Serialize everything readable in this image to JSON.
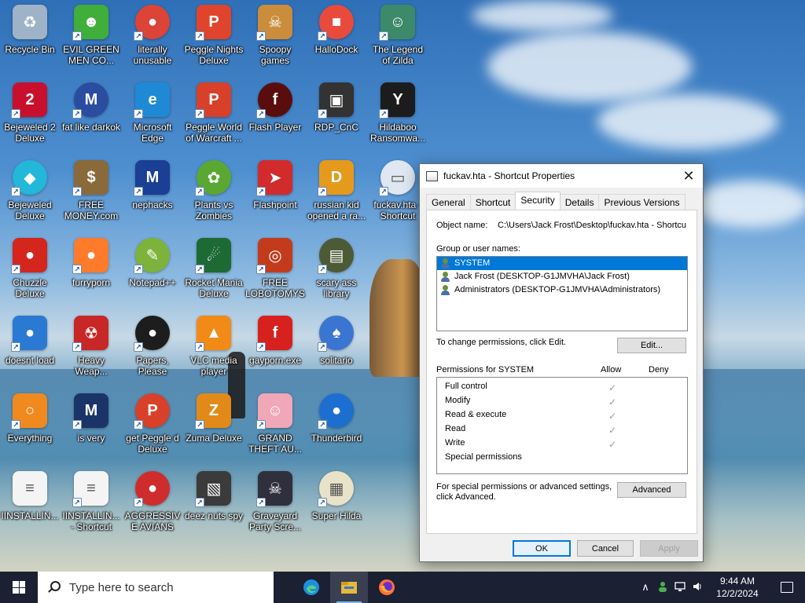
{
  "desktop": {
    "icons": [
      {
        "label": "Recycle Bin",
        "glyph": "♻",
        "color": "#9fb3c8",
        "shortcut": false
      },
      {
        "label": "EVIL GREEN MEN CO...",
        "glyph": "☻",
        "color": "#3fae3a",
        "shortcut": true
      },
      {
        "label": "literally unusable",
        "glyph": "●",
        "color": "#db4437",
        "shortcut": true
      },
      {
        "label": "Peggle Nights Deluxe",
        "glyph": "P",
        "color": "#e0442c",
        "shortcut": true
      },
      {
        "label": "Spoopy games",
        "glyph": "☠",
        "color": "#c98d3c",
        "shortcut": true
      },
      {
        "label": "HalloDock",
        "glyph": "■",
        "color": "#e84b3c",
        "shortcut": true
      },
      {
        "label": "The Legend of Zilda",
        "glyph": "☺",
        "color": "#3c8a6a",
        "shortcut": true
      },
      {
        "label": "Bejeweled 2 Deluxe",
        "glyph": "2",
        "color": "#c8102e",
        "shortcut": true
      },
      {
        "label": "fat like darkok",
        "glyph": "M",
        "color": "#2a4da0",
        "shortcut": true
      },
      {
        "label": "Microsoft Edge",
        "glyph": "e",
        "color": "#1e8ad6",
        "shortcut": true
      },
      {
        "label": "Peggle World of Warcraft ...",
        "glyph": "P",
        "color": "#d8402a",
        "shortcut": true
      },
      {
        "label": "Flash Player",
        "glyph": "f",
        "color": "#5a0d0d",
        "shortcut": true
      },
      {
        "label": "RDP_CnC",
        "glyph": "▣",
        "color": "#333333",
        "shortcut": true
      },
      {
        "label": "Hildaboo Ransomwa...",
        "glyph": "Y",
        "color": "#1c1c1c",
        "shortcut": true
      },
      {
        "label": "Bejeweled Deluxe",
        "glyph": "◆",
        "color": "#23b7d9",
        "shortcut": true
      },
      {
        "label": "FREE MONEY.com",
        "glyph": "$",
        "color": "#8a6a3a",
        "shortcut": true
      },
      {
        "label": "nephacks",
        "glyph": "M",
        "color": "#1b3f94",
        "shortcut": true
      },
      {
        "label": "Plants vs Zombies",
        "glyph": "✿",
        "color": "#5aa832",
        "shortcut": true
      },
      {
        "label": "Flashpoint",
        "glyph": "➤",
        "color": "#d22b2b",
        "shortcut": true
      },
      {
        "label": "russian kid opened a ra...",
        "glyph": "D",
        "color": "#e59a1c",
        "shortcut": true
      },
      {
        "label": "fuckav.hta - Shortcut",
        "glyph": "▭",
        "color": "#dfe7f2",
        "shortcut": true
      },
      {
        "label": "Chuzzle Deluxe",
        "glyph": "●",
        "color": "#d4261d",
        "shortcut": true
      },
      {
        "label": "furryporn",
        "glyph": "●",
        "color": "#ff7b2c",
        "shortcut": true
      },
      {
        "label": "Notepad++",
        "glyph": "✎",
        "color": "#7db33a",
        "shortcut": true
      },
      {
        "label": "Rocket Mania Deluxe",
        "glyph": "☄",
        "color": "#1d6a35",
        "shortcut": true
      },
      {
        "label": "FREE LOBOTOMYS",
        "glyph": "◎",
        "color": "#c33b1d",
        "shortcut": true
      },
      {
        "label": "scary ass library",
        "glyph": "▤",
        "color": "#4d5a36",
        "shortcut": true
      },
      {
        "label": "doesnt load",
        "glyph": "●",
        "color": "#2a7ad3",
        "shortcut": true
      },
      {
        "label": "Heavy Weap...",
        "glyph": "☢",
        "color": "#c72727",
        "shortcut": true
      },
      {
        "label": "Papers, Please",
        "glyph": "●",
        "color": "#1d1d1d",
        "shortcut": true
      },
      {
        "label": "VLC media player",
        "glyph": "▲",
        "color": "#f28a18",
        "shortcut": true
      },
      {
        "label": "gayporn.exe",
        "glyph": "f",
        "color": "#d7211f",
        "shortcut": true
      },
      {
        "label": "solitario",
        "glyph": "♠",
        "color": "#3a75d2",
        "shortcut": true
      },
      {
        "label": "Everything",
        "glyph": "○",
        "color": "#f08a1f",
        "shortcut": true
      },
      {
        "label": "is very",
        "glyph": "M",
        "color": "#1b3468",
        "shortcut": true
      },
      {
        "label": "get Peggle d Deluxe",
        "glyph": "P",
        "color": "#d8402a",
        "shortcut": true
      },
      {
        "label": "Zuma Deluxe",
        "glyph": "Z",
        "color": "#e18a1a",
        "shortcut": true
      },
      {
        "label": "GRAND THEFT AU...",
        "glyph": "☺",
        "color": "#f0a7b8",
        "shortcut": true
      },
      {
        "label": "Thunderbird",
        "glyph": "●",
        "color": "#1c6fd1",
        "shortcut": true
      },
      {
        "label": "IINSTALLIN...",
        "glyph": "≡",
        "color": "#f4f4f4",
        "shortcut": false
      },
      {
        "label": "IINSTALLIN... - Shortcut",
        "glyph": "≡",
        "color": "#f4f4f4",
        "shortcut": true
      },
      {
        "label": "AGGRESSIVE AVIANS",
        "glyph": "●",
        "color": "#cf2d2d",
        "shortcut": true
      },
      {
        "label": "deez nuts spy",
        "glyph": "▧",
        "color": "#3b3b3b",
        "shortcut": true
      },
      {
        "label": "Graveyard Party Scre...",
        "glyph": "☠",
        "color": "#2f2f3d",
        "shortcut": true
      },
      {
        "label": "Super Hilda",
        "glyph": "▦",
        "color": "#e8e2c8",
        "shortcut": true
      }
    ]
  },
  "dialog": {
    "title": "fuckav.hta - Shortcut Properties",
    "close_glyph": "✕",
    "tabs": [
      "General",
      "Shortcut",
      "Security",
      "Details",
      "Previous Versions"
    ],
    "active_tab": "Security",
    "object_name_label": "Object name:",
    "object_name_value": "C:\\Users\\Jack Frost\\Desktop\\fuckav.hta - Shortcu",
    "group_label": "Group or user names:",
    "groups": [
      {
        "name": "SYSTEM",
        "selected": true
      },
      {
        "name": "Jack Frost (DESKTOP-G1JMVHA\\Jack Frost)",
        "selected": false
      },
      {
        "name": "Administrators (DESKTOP-G1JMVHA\\Administrators)",
        "selected": false
      }
    ],
    "change_hint": "To change permissions, click Edit.",
    "edit_button": "Edit...",
    "perm_header": "Permissions for SYSTEM",
    "allow_header": "Allow",
    "deny_header": "Deny",
    "permissions": [
      {
        "name": "Full control",
        "allow": true
      },
      {
        "name": "Modify",
        "allow": true
      },
      {
        "name": "Read & execute",
        "allow": true
      },
      {
        "name": "Read",
        "allow": true
      },
      {
        "name": "Write",
        "allow": true
      },
      {
        "name": "Special permissions",
        "allow": false
      }
    ],
    "advanced_hint_1": "For special permissions or advanced settings,",
    "advanced_hint_2": "click Advanced.",
    "advanced_button": "Advanced",
    "ok_button": "OK",
    "cancel_button": "Cancel",
    "apply_button": "Apply"
  },
  "taskbar": {
    "search_placeholder": "Type here to search",
    "apps": [
      "edge-icon",
      "file-explorer-icon",
      "firefox-icon"
    ],
    "tray_chevron": "∧",
    "time": "9:44 AM",
    "date": "12/2/2024"
  },
  "colors": {
    "accent": "#0078d7",
    "taskbar": "#1b2033"
  }
}
